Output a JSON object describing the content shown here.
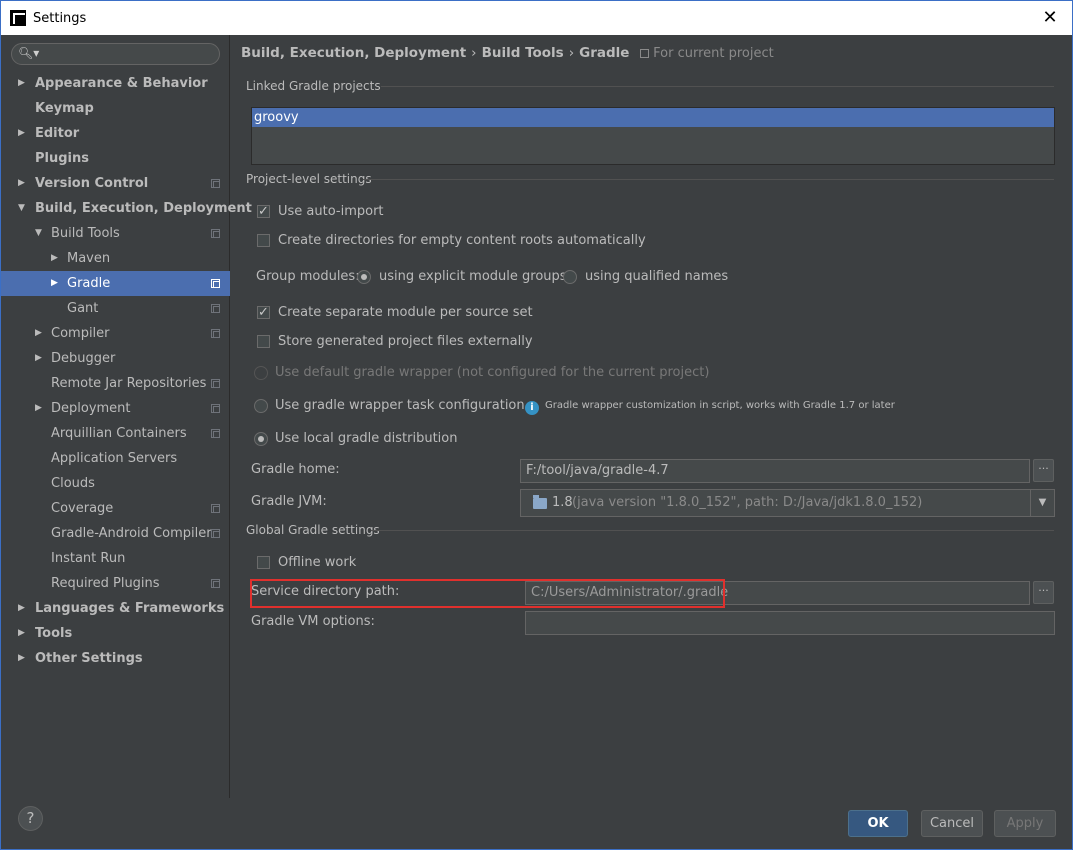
{
  "window": {
    "title": "Settings"
  },
  "search": {
    "placeholder": ""
  },
  "sidebar": {
    "items": [
      {
        "label": "Appearance & Behavior"
      },
      {
        "label": "Keymap"
      },
      {
        "label": "Editor"
      },
      {
        "label": "Plugins"
      },
      {
        "label": "Version Control"
      },
      {
        "label": "Build, Execution, Deployment"
      },
      {
        "label": "Build Tools"
      },
      {
        "label": "Maven"
      },
      {
        "label": "Gradle"
      },
      {
        "label": "Gant"
      },
      {
        "label": "Compiler"
      },
      {
        "label": "Debugger"
      },
      {
        "label": "Remote Jar Repositories"
      },
      {
        "label": "Deployment"
      },
      {
        "label": "Arquillian Containers"
      },
      {
        "label": "Application Servers"
      },
      {
        "label": "Clouds"
      },
      {
        "label": "Coverage"
      },
      {
        "label": "Gradle-Android Compiler"
      },
      {
        "label": "Instant Run"
      },
      {
        "label": "Required Plugins"
      },
      {
        "label": "Languages & Frameworks"
      },
      {
        "label": "Tools"
      },
      {
        "label": "Other Settings"
      }
    ]
  },
  "breadcrumb": {
    "part1": "Build, Execution, Deployment",
    "part2": "Build Tools",
    "part3": "Gradle",
    "sep": "›",
    "scope": "For current project"
  },
  "linked": {
    "title": "Linked Gradle projects",
    "projects": [
      "groovy"
    ]
  },
  "project_level": {
    "title": "Project-level settings",
    "auto_import": "Use auto-import",
    "create_dirs": "Create directories for empty content roots automatically",
    "group_modules_label": "Group modules:",
    "group_option1": "using explicit module groups",
    "group_option2": "using qualified names",
    "separate_module": "Create separate module per source set",
    "store_external": "Store generated project files externally",
    "default_wrapper": "Use default gradle wrapper (not configured for the current project)",
    "wrapper_task": "Use gradle wrapper task configuration",
    "wrapper_info": "Gradle wrapper customization in script, works with Gradle 1.7 or later",
    "local_dist": "Use local gradle distribution",
    "gradle_home_label": "Gradle home:",
    "gradle_home_value": "F:/tool/java/gradle-4.7",
    "gradle_jvm_label": "Gradle JVM:",
    "gradle_jvm_version": "1.8",
    "gradle_jvm_detail": "(java version \"1.8.0_152\", path: D:/Java/jdk1.8.0_152)"
  },
  "global": {
    "title": "Global Gradle settings",
    "offline": "Offline work",
    "service_dir_label": "Service directory path:",
    "service_dir_value": "C:/Users/Administrator/.gradle",
    "vm_options_label": "Gradle VM options:",
    "vm_options_value": ""
  },
  "footer": {
    "help": "?",
    "ok": "OK",
    "cancel": "Cancel",
    "apply": "Apply"
  },
  "colors": {
    "background": "#3c3f41",
    "selection": "#4b6eaf",
    "highlight_box": "#e0302d",
    "ok_button": "#365880"
  }
}
